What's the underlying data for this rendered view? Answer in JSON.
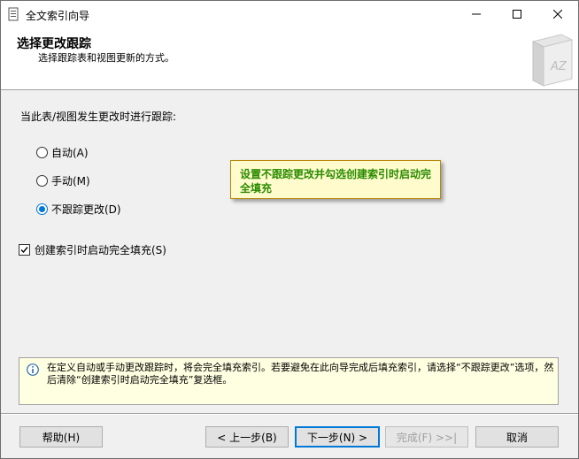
{
  "window": {
    "title": "全文索引向导"
  },
  "titlebar_icons": {
    "app": "document-icon",
    "minimize": "minimize-icon",
    "maximize": "maximize-icon",
    "close": "close-icon"
  },
  "header": {
    "title": "选择更改跟踪",
    "subtitle": "选择跟踪表和视图更新的方式。",
    "icon": "book-az-icon"
  },
  "main": {
    "prompt": "当此表/视图发生更改时进行跟踪:",
    "options": [
      {
        "label": "自动(A)",
        "checked": false
      },
      {
        "label": "手动(M)",
        "checked": false
      },
      {
        "label": "不跟踪更改(D)",
        "checked": true
      }
    ],
    "checkbox": {
      "label": "创建索引时启动完全填充(S)",
      "checked": true
    }
  },
  "callout": {
    "text": "设置不跟踪更改并勾选创建索引时启动完全填充"
  },
  "info": {
    "icon": "info-icon",
    "text": "在定义自动或手动更改跟踪时，将会完全填充索引。若要避免在此向导完成后填充索引，请选择“不跟踪更改”选项，然后清除“创建索引时启动完全填充”复选框。"
  },
  "buttons": {
    "help": "帮助(H)",
    "back": "< 上一步(B)",
    "next": "下一步(N) >",
    "finish": "完成(F) >>|",
    "cancel": "取消"
  },
  "colors": {
    "accent": "#0078d7",
    "callout_text": "#2a8c00",
    "callout_bg": "#fffbcc",
    "info_bg": "#ffffe1"
  }
}
